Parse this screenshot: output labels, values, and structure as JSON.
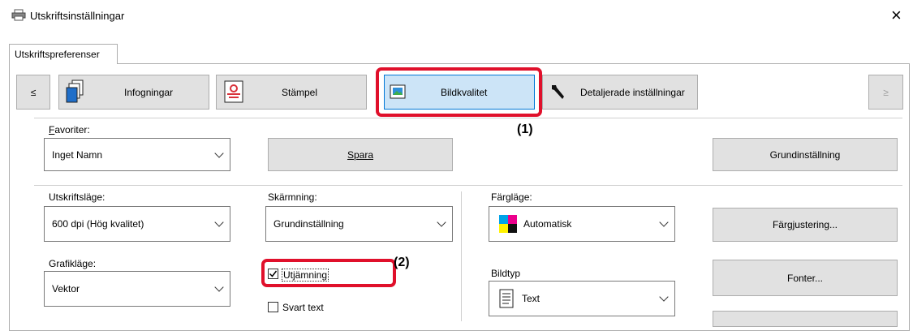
{
  "window": {
    "title": "Utskriftsinställningar",
    "close_glyph": "×"
  },
  "outer_tab": "Utskriftspreferenser",
  "toolbar": {
    "prev": "≤",
    "next": "≥",
    "tabs": [
      {
        "label": "Infogningar",
        "icon": "pages-icon"
      },
      {
        "label": "Stämpel",
        "icon": "stamp-icon"
      },
      {
        "label": "Bildkvalitet",
        "icon": "image-quality-icon"
      },
      {
        "label": "Detaljerade inställningar",
        "icon": "wrench-icon"
      }
    ]
  },
  "favorites": {
    "label": "Favoriter:",
    "value": "Inget Namn",
    "save": "Spara",
    "default": "Grundinställning"
  },
  "print_mode": {
    "label": "Utskriftsläge:",
    "value": "600 dpi (Hög kvalitet)"
  },
  "screening": {
    "label": "Skärmning:",
    "value": "Grundinställning"
  },
  "color_mode": {
    "label": "Färgläge:",
    "value": "Automatisk"
  },
  "color_adjust": "Färgjustering...",
  "graphics_mode": {
    "label": "Grafikläge:",
    "value": "Vektor"
  },
  "smoothing": {
    "label": "Utjämning",
    "checked": true
  },
  "black_text": {
    "label": "Svart text",
    "checked": false
  },
  "image_type": {
    "label": "Bildtyp",
    "value": "Text"
  },
  "fonts": "Fonter...",
  "callouts": {
    "one": "(1)",
    "two": "(2)"
  },
  "colors": {
    "highlight_red": "#e0102b",
    "selected_tab": "#cce4f7",
    "selected_tab_border": "#0078d7"
  }
}
